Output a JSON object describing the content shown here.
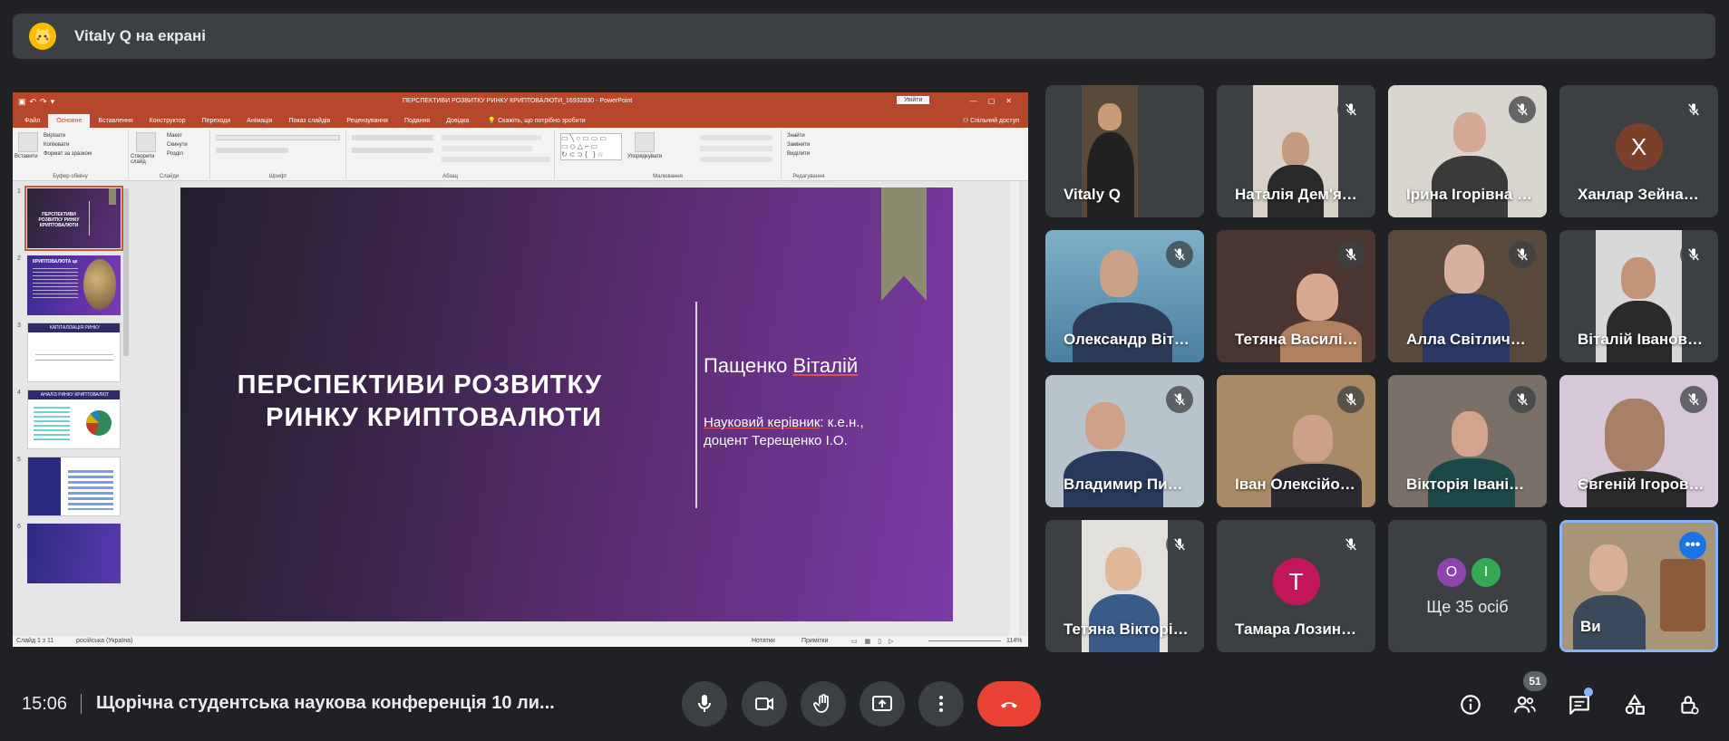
{
  "banner": {
    "title": "Vitaly Q на екрані"
  },
  "powerpoint": {
    "doc_title": "ПЕРСПЕКТИВИ РОЗВИТКУ РИНКУ КРИПТОВАЛЮТИ_16932830 - PowerPoint",
    "login": "Увійти",
    "tabs": [
      "Файл",
      "Основне",
      "Вставлення",
      "Конструктор",
      "Переходи",
      "Анімація",
      "Показ слайдів",
      "Рецензування",
      "Подання",
      "Довідка"
    ],
    "tell_me": "Скажіть, що потрібно зробити",
    "share": "Спільний доступ",
    "ribbon_groups": [
      "Буфер обміну",
      "Слайди",
      "Шрифт",
      "Абзац",
      "Малювання",
      "Редагування"
    ],
    "ribbon": {
      "paste": "Вставити",
      "cut": "Вирізати",
      "copy": "Копіювати",
      "format_painter": "Формат за зразком",
      "new_slide": "Створити слайд",
      "layout": "Макет",
      "reset": "Скинути",
      "section": "Розділ",
      "arrange": "Упорядкувати",
      "find": "Знайти",
      "replace": "Замінити",
      "select": "Виділити"
    },
    "thumb_numbers": [
      "1",
      "2",
      "3",
      "4",
      "5",
      "6"
    ],
    "thumb1_title": "ПЕРСПЕКТИВИ РОЗВИТКУ РИНКУ КРИПТОВАЛЮТИ",
    "thumb2_title": "КРИПТОВАЛЮТА це",
    "thumb3_title": "КАПІТАЛІЗАЦІЯ РИНКУ",
    "thumb4_title": "АНАЛІЗ РИНКУ КРИПТОВАЛЮТ",
    "slide": {
      "title_line1": "ПЕРСПЕКТИВИ РОЗВИТКУ",
      "title_line2": "РИНКУ КРИПТОВАЛЮТИ",
      "author_first": "Пащенко ",
      "author_second": "Віталій",
      "advisor_label": "Науковий керівник",
      "advisor_rest": ": к.е.н.,",
      "advisor_line2": "доцент Терещенко І.О."
    },
    "status": {
      "slide_counter": "Слайд 1 з 11",
      "language": "російська (Україна)",
      "notes": "Нотатки",
      "comments": "Примітки",
      "zoom": "114%"
    }
  },
  "participants": [
    {
      "name": "Vitaly Q",
      "muted": false
    },
    {
      "name": "Наталія Дем'яненко",
      "muted": true
    },
    {
      "name": "Ірина Ігорівна Петренко",
      "muted": true
    },
    {
      "name": "Ханлар Зейналов",
      "muted": true,
      "avatar_letter": "Х",
      "avatar_color": "#7b3f2a"
    },
    {
      "name": "Олександр Віталійович",
      "muted": true
    },
    {
      "name": "Тетяна Василівна",
      "muted": true
    },
    {
      "name": "Алла Світличная",
      "muted": true
    },
    {
      "name": "Віталій Іванович",
      "muted": true
    },
    {
      "name": "Владимир Пилипенко",
      "muted": true
    },
    {
      "name": "Іван Олексійович",
      "muted": true
    },
    {
      "name": "Вікторія Іванівна",
      "muted": true
    },
    {
      "name": "Євгеній Ігорович",
      "muted": true
    },
    {
      "name": "Тетяна Вікторівна",
      "muted": true
    },
    {
      "name": "Тамара Лозинська",
      "muted": true,
      "avatar_letter": "Т",
      "avatar_color": "#c2185b"
    }
  ],
  "more_tile": {
    "label": "Ще 35 осіб",
    "avatars": [
      {
        "letter": "О",
        "color": "#8e44ad"
      },
      {
        "letter": "І",
        "color": "#34a853"
      }
    ]
  },
  "self_tile": {
    "name": "Ви",
    "more_icon": "•••"
  },
  "bottom": {
    "time": "15:06",
    "meeting": "Щорічна студентська наукова конференція 10 ли...",
    "participants_count": "51"
  },
  "colors": {
    "background": "#202124",
    "panel": "#3c4043",
    "end_call": "#ea4335",
    "accent": "#8ab4f8"
  }
}
